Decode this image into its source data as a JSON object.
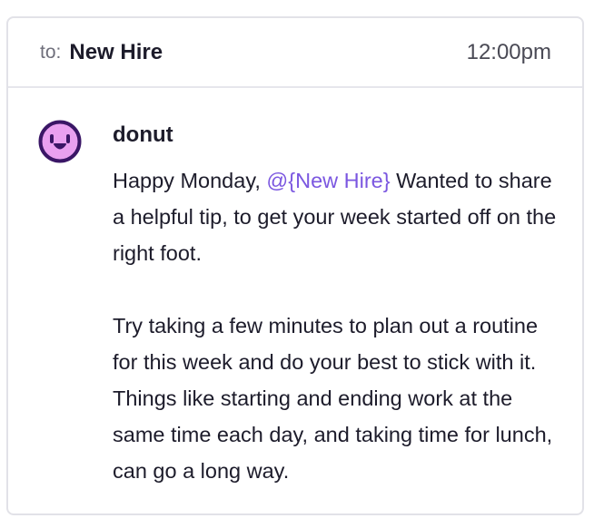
{
  "header": {
    "to_label": "to:",
    "recipient": "New Hire",
    "time": "12:00pm"
  },
  "message": {
    "avatar_icon": "donut-face-icon",
    "sender": "donut",
    "para1_before": "Happy Monday, ",
    "mention": "@{New Hire}",
    "para1_after": " Wanted to share a helpful tip, to get your week started off on the right foot.",
    "para2": "Try taking a few minutes to plan out a routine for this week and do your best to stick with it. Things like starting and ending work at the same time each day, and taking time for lunch, can go a long way."
  },
  "colors": {
    "accent": "#7b57e0",
    "avatar_fill": "#e9a0f0",
    "avatar_outline": "#3a1666"
  }
}
